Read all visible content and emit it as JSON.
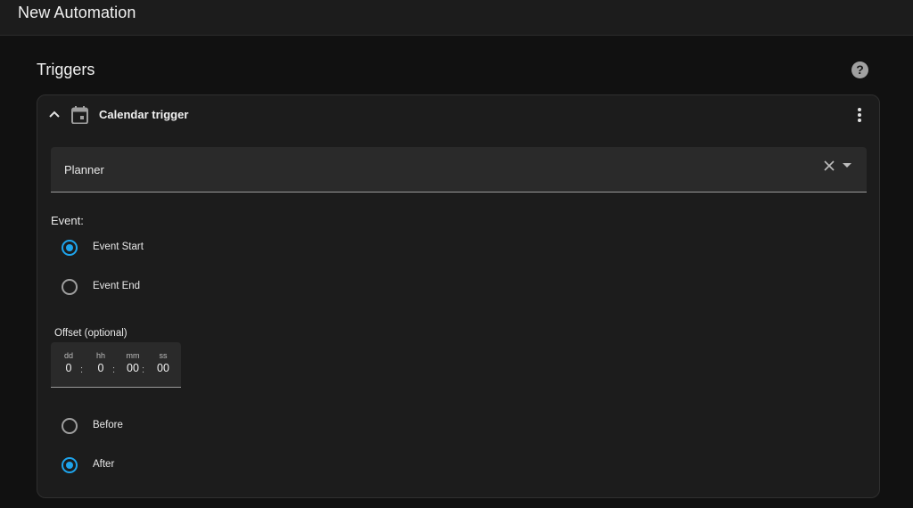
{
  "header": {
    "title": "New Automation"
  },
  "triggers": {
    "title": "Triggers",
    "help_icon": "help-circle-icon",
    "card": {
      "name": "Calendar trigger",
      "icons": {
        "collapse": "chevron-up-icon",
        "type": "calendar-icon",
        "menu": "dots-vertical-icon"
      },
      "calendar_select": {
        "value": "Planner",
        "clear_icon": "close-icon",
        "dropdown_icon": "menu-down-icon"
      },
      "event": {
        "label": "Event:",
        "options": [
          {
            "label": "Event Start",
            "checked": true
          },
          {
            "label": "Event End",
            "checked": false
          }
        ]
      },
      "offset": {
        "label": "Offset (optional)",
        "fields": [
          {
            "unit": "dd",
            "value": "0"
          },
          {
            "unit": "hh",
            "value": "0"
          },
          {
            "unit": "mm",
            "value": "00"
          },
          {
            "unit": "ss",
            "value": "00"
          }
        ],
        "separator": ":"
      },
      "offset_type": {
        "options": [
          {
            "label": "Before",
            "checked": false
          },
          {
            "label": "After",
            "checked": true
          }
        ]
      }
    }
  },
  "colors": {
    "accent": "#1ea4ec",
    "background": "#111111",
    "card": "#1c1c1c",
    "field": "#2a2a2a"
  }
}
